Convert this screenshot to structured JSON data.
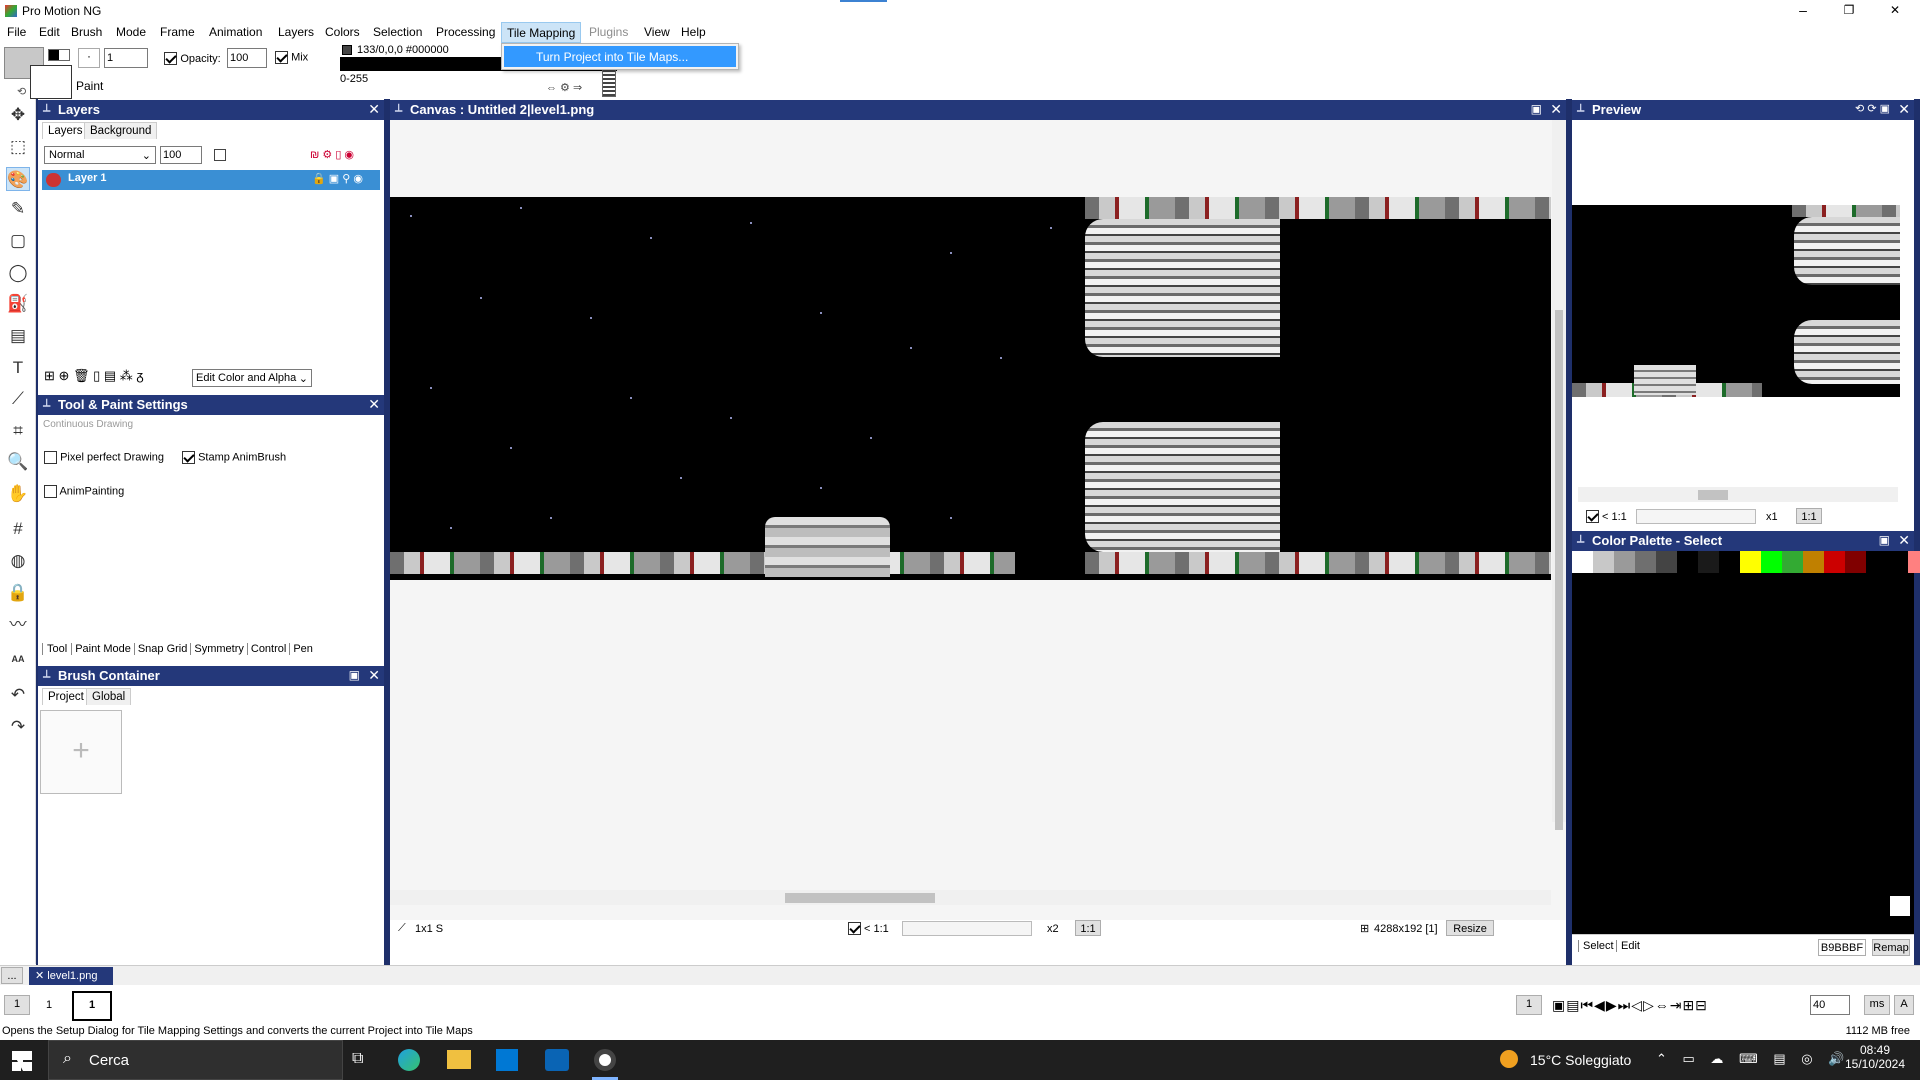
{
  "window": {
    "title": "Pro Motion NG",
    "min": "–",
    "max": "❐",
    "close": "✕"
  },
  "menu": [
    "File",
    "Edit",
    "Brush",
    "Mode",
    "Frame",
    "Animation",
    "Layers",
    "Colors",
    "Selection",
    "Processing",
    "Tile Mapping",
    "Plugins",
    "View",
    "Help"
  ],
  "dropdown": {
    "item": "Turn Project into Tile Maps..."
  },
  "toolbar": {
    "brush_size": "1",
    "opacity_label": "Opacity:",
    "opacity": "100",
    "mix": "Mix",
    "paint": "Paint",
    "color_info": "133/0,0,0 #000000",
    "range": "0-255",
    "dot": "·"
  },
  "layers": {
    "title": "Layers",
    "tab_layers": "Layers",
    "tab_background": "Background",
    "blend": "Normal",
    "opacity": "100",
    "layer_name": "Layer 1",
    "edit_mode": "Edit Color and Alpha"
  },
  "toolsettings": {
    "title": "Tool & Paint Settings",
    "hint": "Continuous Drawing",
    "pixel_perfect": "Pixel perfect Drawing",
    "stamp_anim": "Stamp AnimBrush",
    "anim_painting": "AnimPainting",
    "tabs": [
      "Tool",
      "Paint Mode",
      "Snap Grid",
      "Symmetry",
      "Control",
      "Pen"
    ]
  },
  "brush": {
    "title": "Brush Container",
    "tab_project": "Project",
    "tab_global": "Global",
    "add": "+"
  },
  "canvas": {
    "title": "Canvas : Untitled 2|level1.png",
    "brush_info": "1x1 S",
    "zoom_ratio": "< 1:1",
    "zoom": "x2",
    "oneone": "1:1",
    "dims": "4288x192 [1]",
    "resize": "Resize"
  },
  "preview": {
    "title": "Preview",
    "zoom_ratio": "< 1:1",
    "zoom": "x1",
    "oneone": "1:1"
  },
  "palette": {
    "title": "Color Palette - Select",
    "select_tab": "Select",
    "edit_tab": "Edit",
    "hex": "B9BBBF",
    "remap": "Remap",
    "colors": [
      "#ffffff",
      "#c8c8c8",
      "#9a9a9a",
      "#6f6f6f",
      "#444444",
      "#000000",
      "#1a1a1a",
      "#000000",
      "#ffff00",
      "#00ff00",
      "#33aa33",
      "#c08000",
      "#cc0000",
      "#800000",
      "#000000",
      "#000000",
      "#ff8080",
      "#0080ff",
      "#0000ff",
      "#000000",
      "#006000"
    ]
  },
  "bottom": {
    "dots": "...",
    "file_tab": "level1.png",
    "frame_left": "1",
    "frame_num": "1",
    "frame_thumb": "1",
    "frame_right": "1",
    "speed": "40",
    "unit": "ms",
    "a": "A",
    "status": "Opens the Setup Dialog for Tile Mapping Settings and converts the current Project into Tile Maps",
    "memory": "1112 MB free"
  },
  "taskbar": {
    "search": "Cerca",
    "weather": "15°C Soleggiato",
    "time": "08:49",
    "date": "15/10/2024"
  }
}
